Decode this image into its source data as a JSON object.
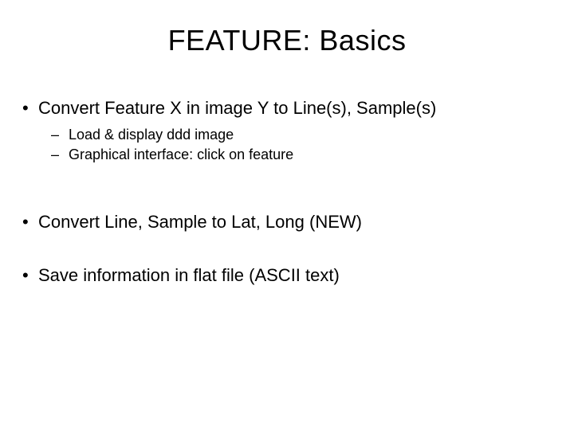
{
  "title": "FEATURE:  Basics",
  "bullets": {
    "b1": "Convert Feature X in image Y to Line(s), Sample(s)",
    "b1_sub1": "Load & display ddd image",
    "b1_sub2": "Graphical interface:  click on feature",
    "b2": "Convert Line, Sample to Lat, Long (NEW)",
    "b3": "Save information in flat file (ASCII text)"
  }
}
